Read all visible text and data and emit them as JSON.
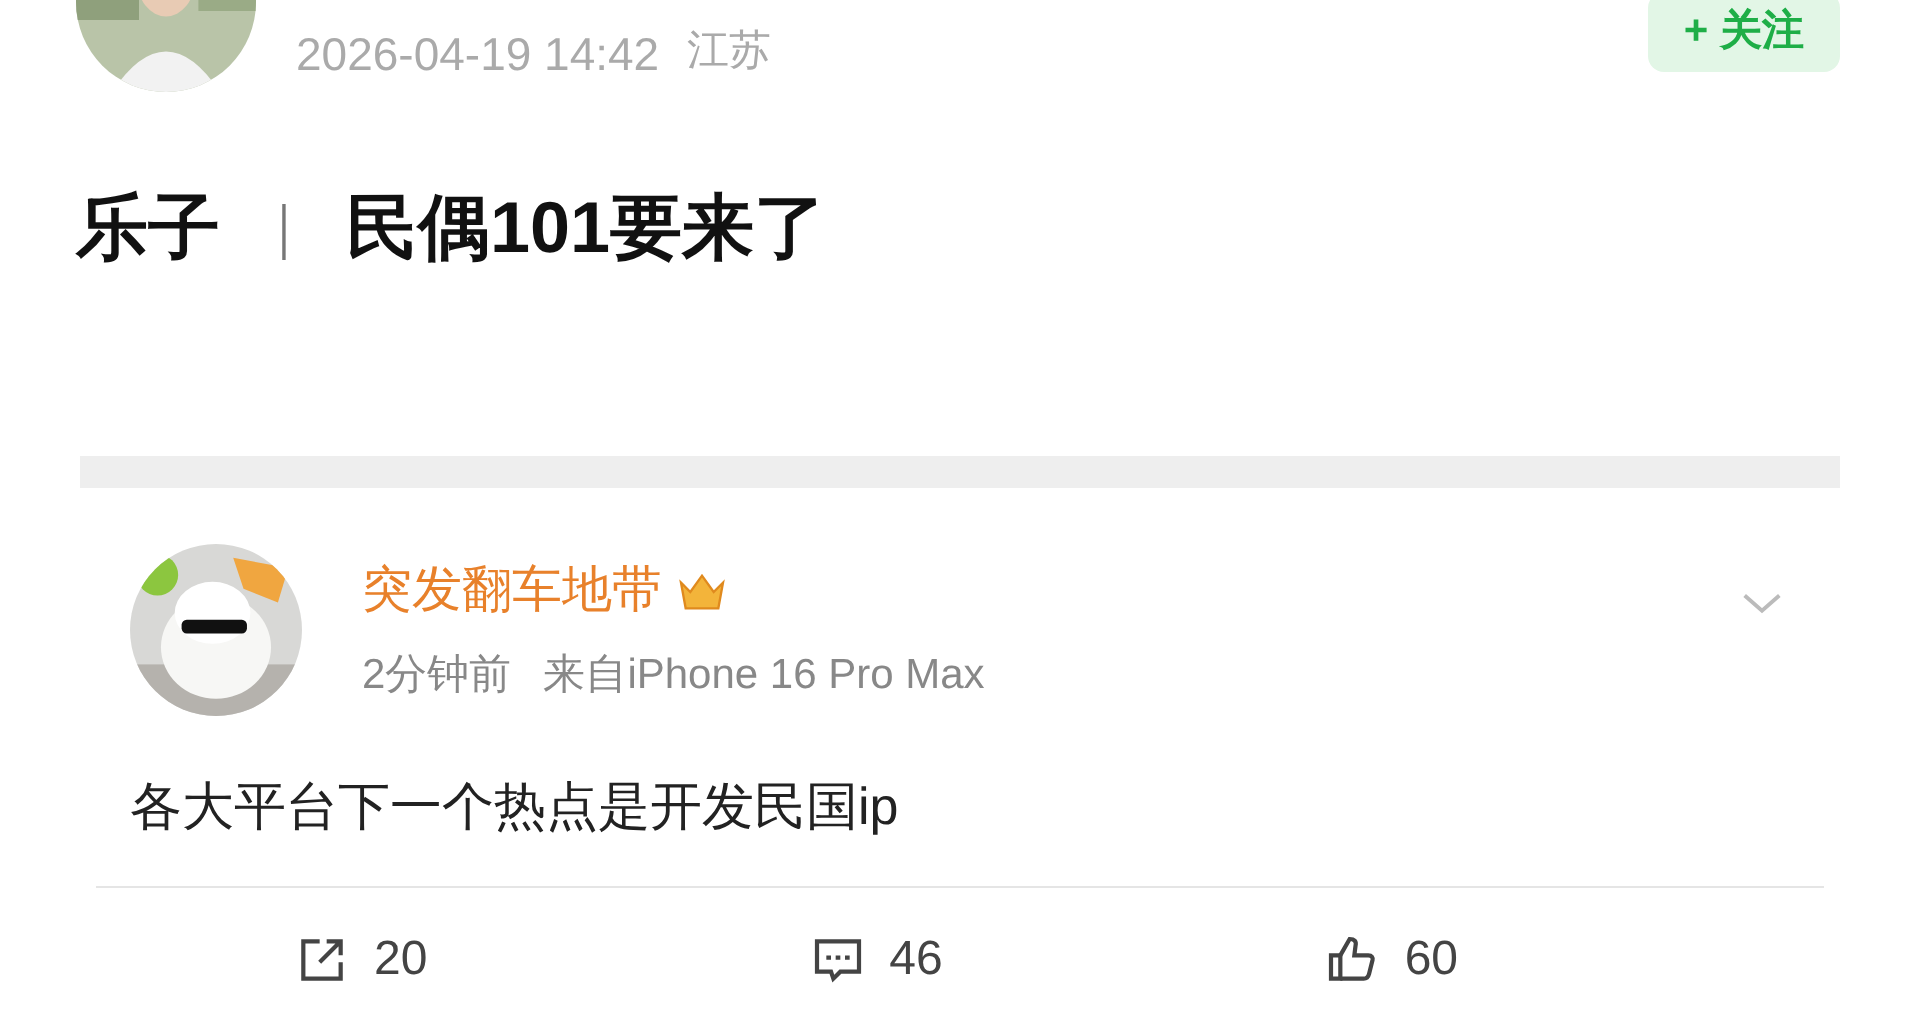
{
  "post": {
    "time": "2026-04-19 14:42",
    "location": "江苏",
    "follow_button": "+ 关注",
    "title": "乐子",
    "separator": "｜",
    "headline": "民偶101要来了"
  },
  "embedded": {
    "author": "突发翻车地带",
    "time": "2分钟前",
    "source": "来自iPhone 16 Pro Max",
    "text": "各大平台下一个热点是开发民国ip",
    "actions": [
      {
        "kind": "share",
        "count": "20"
      },
      {
        "kind": "comment",
        "count": "46"
      },
      {
        "kind": "like",
        "count": "60"
      }
    ]
  }
}
